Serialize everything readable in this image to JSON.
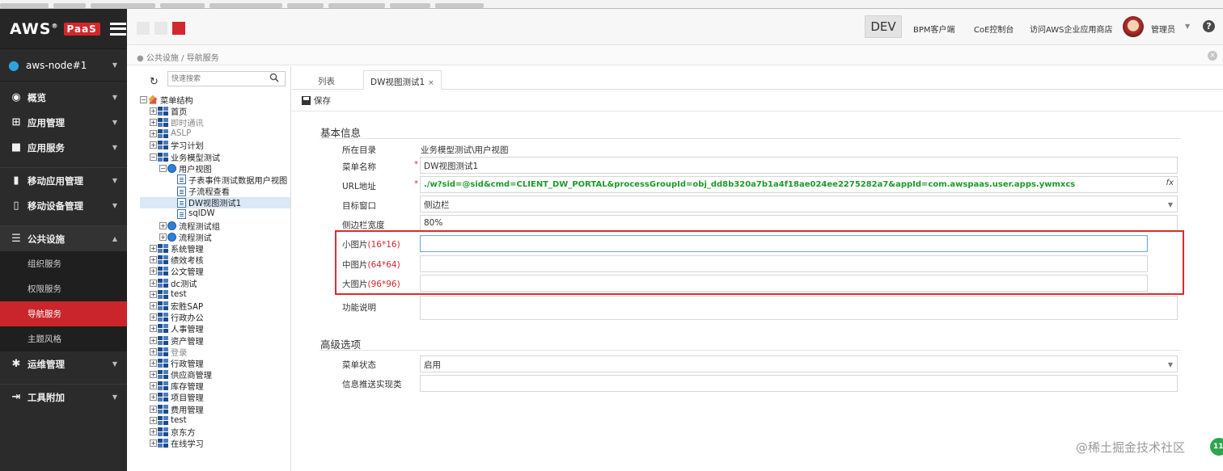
{
  "brand": {
    "name": "AWS",
    "reg": "®",
    "badge": "PaaS"
  },
  "sidebar": {
    "node": "aws-node#1",
    "items": [
      {
        "label": "概览"
      },
      {
        "label": "应用管理"
      },
      {
        "label": "应用服务"
      },
      {
        "label": "移动应用管理"
      },
      {
        "label": "移动设备管理"
      },
      {
        "label": "公共设施"
      },
      {
        "label": "运维管理"
      },
      {
        "label": "工具附加"
      }
    ],
    "sub": [
      "组织服务",
      "权限服务",
      "导航服务",
      "主题风格"
    ]
  },
  "header": {
    "env": "DEV",
    "links": [
      "BPM客户端",
      "CoE控制台",
      "访问AWS企业应用商店"
    ],
    "user": "管理员",
    "colors": {
      "sq1": "#e8e8e8",
      "sq2": "#e8e8e8",
      "sq3": "#d0282e"
    }
  },
  "breadcrumb": "公共设施 / 导航服务",
  "tree": {
    "search_placeholder": "快速搜索",
    "nodes": [
      "菜单结构",
      "首页",
      "即时通讯",
      "ASLP",
      "学习计划",
      "业务模型测试",
      "用户视图",
      "子表事件测试数据用户视图",
      "子流程查看",
      "DW视图测试1",
      "sqlDW",
      "流程测试组",
      "流程测试",
      "系统管理",
      "绩效考核",
      "公文管理",
      "dc测试",
      "test",
      "宏胜SAP",
      "行政办公",
      "人事管理",
      "资产管理",
      "登录",
      "行政管理",
      "供应商管理",
      "库存管理",
      "项目管理",
      "费用管理",
      "test",
      "京东方",
      "在线学习"
    ]
  },
  "tabs": {
    "list": "列表",
    "active": "DW视图测试1",
    "close": "×"
  },
  "toolbar": {
    "save": "保存"
  },
  "form": {
    "basic_title": "基本信息",
    "advanced_title": "高级选项",
    "labels": {
      "dir": "所在目录",
      "name": "菜单名称",
      "url": "URL地址",
      "target": "目标窗口",
      "width": "侧边栏宽度",
      "small": "小图片",
      "small_size": "(16*16)",
      "mid": "中图片",
      "mid_size": "(64*64)",
      "large": "大图片",
      "large_size": "(96*96)",
      "desc": "功能说明",
      "status": "菜单状态",
      "push": "信息推送实现类"
    },
    "values": {
      "dir": "业务模型测试\\用户视图",
      "name": "DW视图测试1",
      "url": "./w?sid=@sid&cmd=CLIENT_DW_PORTAL&processGroupId=obj_dd8b320a7b1a4f18ae024ee2275282a7&appId=com.awspaas.user.apps.ywmxcs",
      "target": "侧边栏",
      "width": "80%",
      "status": "启用",
      "fx": "fx"
    },
    "required_mark": "*"
  },
  "watermark": "@稀土掘金技术社区",
  "badge_count": "11"
}
